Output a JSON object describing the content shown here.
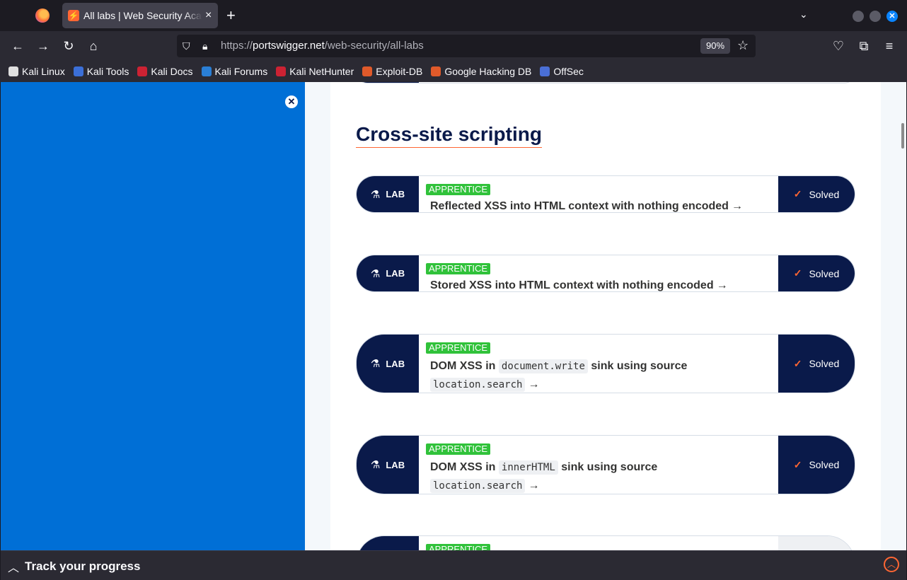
{
  "browser": {
    "tab_title": "All labs | Web Security Academy",
    "tab_close": "×",
    "new_tab": "+",
    "url_scheme": "https://",
    "url_host": "portswigger.net",
    "url_path": "/web-security/all-labs",
    "zoom": "90%"
  },
  "bookmarks": [
    {
      "label": "Kali Linux",
      "icon": "kali-dragon-icon",
      "color": "#e0e0e0"
    },
    {
      "label": "Kali Tools",
      "icon": "kali-tools-icon",
      "color": "#3b6fd8"
    },
    {
      "label": "Kali Docs",
      "icon": "kali-docs-icon",
      "color": "#cc2233"
    },
    {
      "label": "Kali Forums",
      "icon": "kali-forums-icon",
      "color": "#2a7fd6"
    },
    {
      "label": "Kali NetHunter",
      "icon": "nethunter-icon",
      "color": "#cc2233"
    },
    {
      "label": "Exploit-DB",
      "icon": "exploit-db-icon",
      "color": "#e05a2a"
    },
    {
      "label": "Google Hacking DB",
      "icon": "ghdb-icon",
      "color": "#e05a2a"
    },
    {
      "label": "OffSec",
      "icon": "offsec-icon",
      "color": "#4a6fd6"
    }
  ],
  "section_title": "Cross-site scripting",
  "lab_label": "LAB",
  "solved_label": "Solved",
  "labs": [
    {
      "level": "APPRENTICE",
      "title_parts": [
        "Reflected XSS into HTML context with nothing encoded"
      ]
    },
    {
      "level": "APPRENTICE",
      "title_parts": [
        "Stored XSS into HTML context with nothing encoded"
      ]
    },
    {
      "level": "APPRENTICE",
      "title_a": "DOM XSS in",
      "code_a": "document.write",
      "title_b": "sink using source",
      "code_b": "location.search"
    },
    {
      "level": "APPRENTICE",
      "title_a": "DOM XSS in",
      "code_a": "innerHTML",
      "title_b": "sink using source",
      "code_b": "location.search"
    },
    {
      "level": "APPRENTICE"
    }
  ],
  "bottom_bar": {
    "label": "Track your progress"
  },
  "colors": {
    "brand_navy": "#0a1a4a",
    "accent_orange": "#ff6633",
    "badge_green": "#30c23a",
    "sidebar_blue": "#006fd6"
  }
}
